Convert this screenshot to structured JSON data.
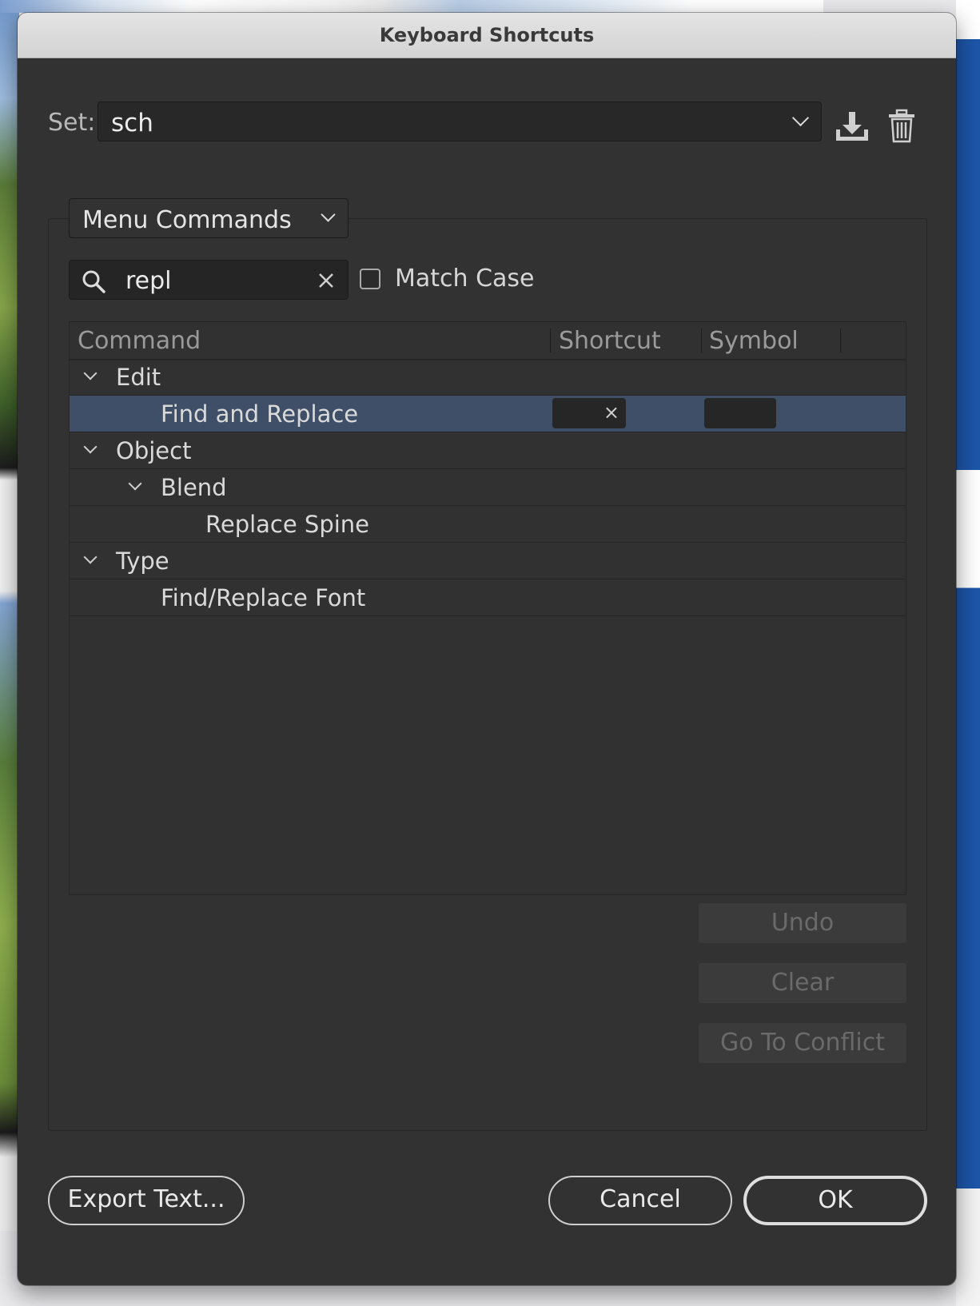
{
  "window": {
    "title": "Keyboard Shortcuts"
  },
  "set": {
    "label": "Set:",
    "value": "sch"
  },
  "icons": {
    "save_set": "download-icon",
    "delete_set": "trash-icon",
    "search": "search-icon",
    "clear_search": "close-icon"
  },
  "command_type": {
    "value": "Menu Commands"
  },
  "search": {
    "value": "repl",
    "match_case_label": "Match Case",
    "match_case_checked": false
  },
  "table": {
    "columns": [
      "Command",
      "Shortcut",
      "Symbol"
    ],
    "rows": [
      {
        "label": "Edit",
        "level": 0,
        "expanded": true
      },
      {
        "label": "Find and Replace",
        "level": 1,
        "selected": true,
        "shortcut": "",
        "symbol": ""
      },
      {
        "label": "Object",
        "level": 0,
        "expanded": true
      },
      {
        "label": "Blend",
        "level": 1,
        "expanded": true
      },
      {
        "label": "Replace Spine",
        "level": 2
      },
      {
        "label": "Type",
        "level": 0,
        "expanded": true
      },
      {
        "label": "Find/Replace Font",
        "level": 1
      }
    ],
    "clear_shortcut_glyph": "×"
  },
  "buttons": {
    "undo": "Undo",
    "clear": "Clear",
    "go_to_conflict": "Go To Conflict",
    "export_text": "Export Text...",
    "cancel": "Cancel",
    "ok": "OK"
  },
  "colors": {
    "dialog_bg": "#323232",
    "selection": "#3f4f68",
    "title_bar": "#d9d9d9"
  }
}
